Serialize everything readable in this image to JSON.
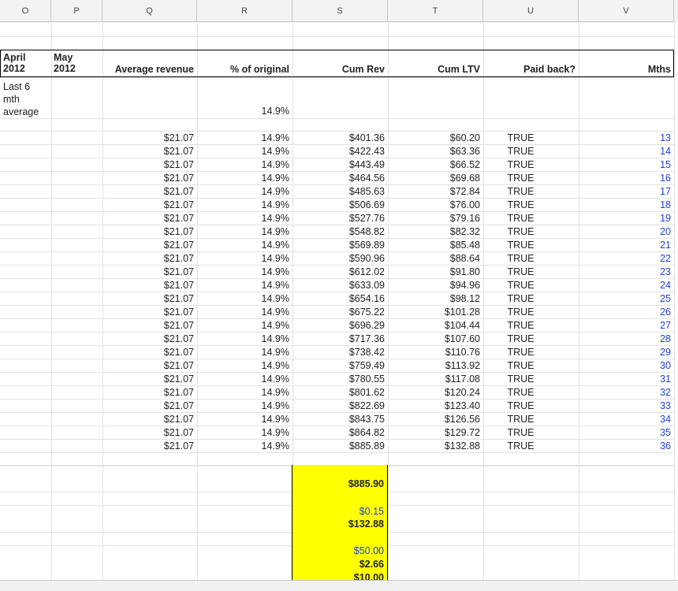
{
  "columns": [
    "O",
    "P",
    "Q",
    "R",
    "S",
    "T",
    "U",
    "V"
  ],
  "headers": {
    "o": [
      "April",
      "2012"
    ],
    "p": [
      "May",
      "2012"
    ],
    "q": "Average revenue",
    "r": "% of original",
    "s": "Cum Rev",
    "t": "Cum LTV",
    "u": "Paid back?",
    "v": "Mths"
  },
  "summary": {
    "label": [
      "Last 6",
      "mth",
      "average"
    ],
    "pct": "14.9%"
  },
  "rows": [
    [
      "$21.07",
      "14.9%",
      "$401.36",
      "$60.20",
      "TRUE",
      "13"
    ],
    [
      "$21.07",
      "14.9%",
      "$422.43",
      "$63.36",
      "TRUE",
      "14"
    ],
    [
      "$21.07",
      "14.9%",
      "$443.49",
      "$66.52",
      "TRUE",
      "15"
    ],
    [
      "$21.07",
      "14.9%",
      "$464.56",
      "$69.68",
      "TRUE",
      "16"
    ],
    [
      "$21.07",
      "14.9%",
      "$485.63",
      "$72.84",
      "TRUE",
      "17"
    ],
    [
      "$21.07",
      "14.9%",
      "$506.69",
      "$76.00",
      "TRUE",
      "18"
    ],
    [
      "$21.07",
      "14.9%",
      "$527.76",
      "$79.16",
      "TRUE",
      "19"
    ],
    [
      "$21.07",
      "14.9%",
      "$548.82",
      "$82.32",
      "TRUE",
      "20"
    ],
    [
      "$21.07",
      "14.9%",
      "$569.89",
      "$85.48",
      "TRUE",
      "21"
    ],
    [
      "$21.07",
      "14.9%",
      "$590.96",
      "$88.64",
      "TRUE",
      "22"
    ],
    [
      "$21.07",
      "14.9%",
      "$612.02",
      "$91.80",
      "TRUE",
      "23"
    ],
    [
      "$21.07",
      "14.9%",
      "$633.09",
      "$94.96",
      "TRUE",
      "24"
    ],
    [
      "$21.07",
      "14.9%",
      "$654.16",
      "$98.12",
      "TRUE",
      "25"
    ],
    [
      "$21.07",
      "14.9%",
      "$675.22",
      "$101.28",
      "TRUE",
      "26"
    ],
    [
      "$21.07",
      "14.9%",
      "$696.29",
      "$104.44",
      "TRUE",
      "27"
    ],
    [
      "$21.07",
      "14.9%",
      "$717.36",
      "$107.60",
      "TRUE",
      "28"
    ],
    [
      "$21.07",
      "14.9%",
      "$738.42",
      "$110.76",
      "TRUE",
      "29"
    ],
    [
      "$21.07",
      "14.9%",
      "$759.49",
      "$113.92",
      "TRUE",
      "30"
    ],
    [
      "$21.07",
      "14.9%",
      "$780.55",
      "$117.08",
      "TRUE",
      "31"
    ],
    [
      "$21.07",
      "14.9%",
      "$801.62",
      "$120.24",
      "TRUE",
      "32"
    ],
    [
      "$21.07",
      "14.9%",
      "$822.69",
      "$123.40",
      "TRUE",
      "33"
    ],
    [
      "$21.07",
      "14.9%",
      "$843.75",
      "$126.56",
      "TRUE",
      "34"
    ],
    [
      "$21.07",
      "14.9%",
      "$864.82",
      "$129.72",
      "TRUE",
      "35"
    ],
    [
      "$21.07",
      "14.9%",
      "$885.89",
      "$132.88",
      "TRUE",
      "36"
    ]
  ],
  "highlight": {
    "total_rev": "$885.90",
    "ratio": "$0.15",
    "ltv": "$132.88",
    "cost": "$50.00",
    "multiple": "$2.66",
    "cut": "$10.00"
  },
  "colors": {
    "highlight": "#ffff00",
    "blue_text": "#1f3fd6"
  }
}
